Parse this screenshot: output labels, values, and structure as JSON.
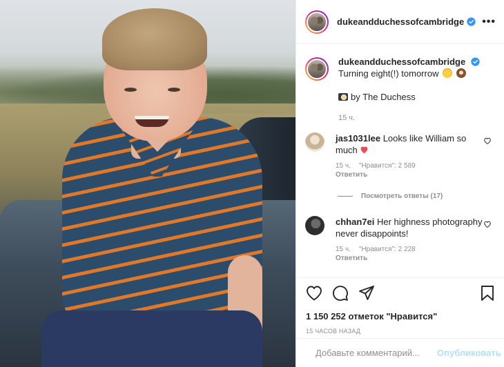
{
  "post": {
    "username": "dukeandduchessofcambridge",
    "caption_line1": "Turning eight(!) tomorrow",
    "caption_line2": "by The Duchess",
    "caption_time": "15 ч."
  },
  "comments": [
    {
      "username": "jas1031lee",
      "text": "Looks like William so much",
      "time": "15 ч.",
      "likes": "\"Нравится\": 2 589",
      "reply": "Ответить",
      "avatar_color": "#d8c9b4"
    },
    {
      "username": "chhan7ei",
      "text": "Her highness photography never disappoints!",
      "time": "15 ч.",
      "likes": "\"Нравится\": 2 228",
      "reply": "Ответить",
      "avatar_color": "#3f3f3f"
    }
  ],
  "view_replies": "Посмотреть ответы (17)",
  "likes_count": "1 150 252 отметок \"Нравится\"",
  "post_time": "15 ЧАСОВ НАЗАД",
  "add_comment": {
    "placeholder": "Добавьте комментарий...",
    "publish_label": "Опубликовать"
  },
  "icons": {
    "header_more": "more-options-icon",
    "verified": "verified-badge-icon",
    "like": "heart-icon",
    "comment": "comment-icon",
    "share": "share-icon",
    "save": "bookmark-icon",
    "emoji": "emoji-icon"
  },
  "colors": {
    "verified_blue": "#3897f0",
    "text": "#262626",
    "muted": "#8e8e8e",
    "publish_disabled": "#b2dffc",
    "heart_red": "#ed4956"
  }
}
